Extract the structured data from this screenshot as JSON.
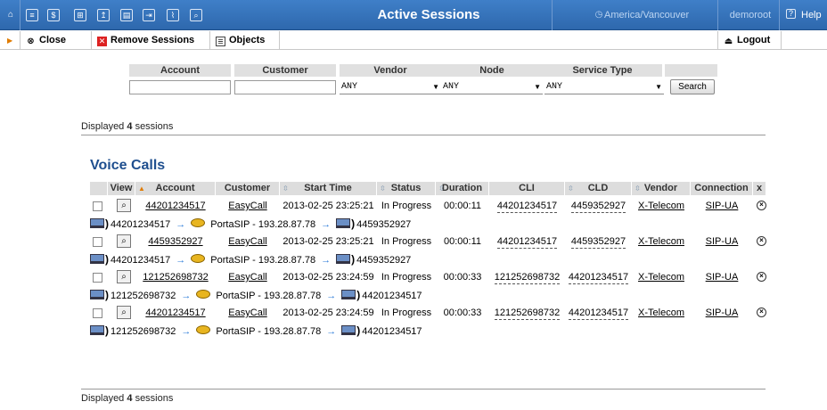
{
  "topbar": {
    "icons": [
      "home-icon",
      "list-icon",
      "dollar-icon",
      "grid-icon",
      "upload-icon",
      "doc-icon",
      "export-icon",
      "chart-icon",
      "zoom-icon"
    ],
    "title": "Active Sessions",
    "timezone": "America/Vancouver",
    "user": "demoroot",
    "help": "Help"
  },
  "toolbar": {
    "close": "Close",
    "remove": "Remove Sessions",
    "objects": "Objects",
    "logout": "Logout"
  },
  "filter": {
    "headers": {
      "account": "Account",
      "customer": "Customer",
      "vendor": "Vendor",
      "node": "Node",
      "service": "Service Type"
    },
    "vendor_value": "ANY",
    "node_value": "ANY",
    "service_value": "ANY",
    "search": "Search"
  },
  "summary": {
    "prefix": "Displayed",
    "count": "4",
    "suffix": "sessions"
  },
  "voice": {
    "title": "Voice Calls",
    "columns": {
      "view": "View",
      "account": "Account",
      "customer": "Customer",
      "start": "Start Time",
      "status": "Status",
      "duration": "Duration",
      "cli": "CLI",
      "cld": "CLD",
      "vendor": "Vendor",
      "connection": "Connection",
      "x": "x"
    },
    "rows": [
      {
        "account": "44201234517",
        "customer": "EasyCall",
        "start": "2013-02-25 23:25:21",
        "status": "In Progress",
        "duration": "00:00:11",
        "cli": "44201234517",
        "cld": "4459352927",
        "vendor": "X-Telecom",
        "connection": "SIP-UA",
        "from": "44201234517",
        "via": "PortaSIP - 193.28.87.78",
        "to": "4459352927"
      },
      {
        "account": "4459352927",
        "customer": "EasyCall",
        "start": "2013-02-25 23:25:21",
        "status": "In Progress",
        "duration": "00:00:11",
        "cli": "44201234517",
        "cld": "4459352927",
        "vendor": "X-Telecom",
        "connection": "SIP-UA",
        "from": "44201234517",
        "via": "PortaSIP - 193.28.87.78",
        "to": "4459352927"
      },
      {
        "account": "121252698732",
        "customer": "EasyCall",
        "start": "2013-02-25 23:24:59",
        "status": "In Progress",
        "duration": "00:00:33",
        "cli": "121252698732",
        "cld": "44201234517",
        "vendor": "X-Telecom",
        "connection": "SIP-UA",
        "from": "121252698732",
        "via": "PortaSIP - 193.28.87.78",
        "to": "44201234517"
      },
      {
        "account": "44201234517",
        "customer": "EasyCall",
        "start": "2013-02-25 23:24:59",
        "status": "In Progress",
        "duration": "00:00:33",
        "cli": "121252698732",
        "cld": "44201234517",
        "vendor": "X-Telecom",
        "connection": "SIP-UA",
        "from": "121252698732",
        "via": "PortaSIP - 193.28.87.78",
        "to": "44201234517"
      }
    ]
  },
  "colors": {
    "topbar": "#3574bd",
    "title": "#1f4f8f",
    "link_arrow": "#2a7ad8"
  }
}
